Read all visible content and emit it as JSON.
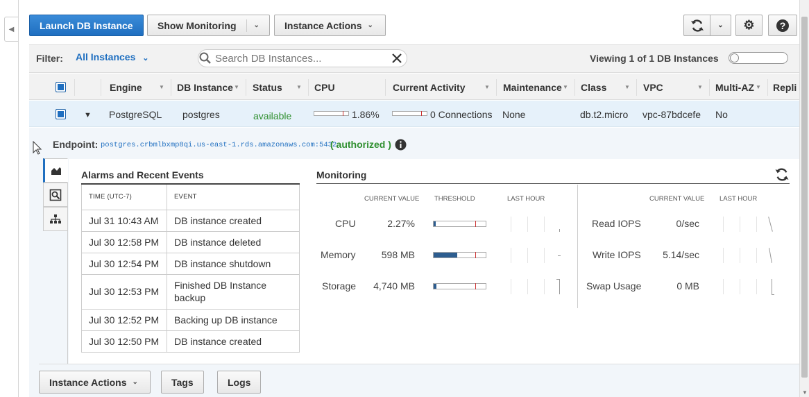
{
  "toolbar": {
    "launch_label": "Launch DB Instance",
    "show_monitoring_label": "Show Monitoring",
    "instance_actions_label": "Instance Actions"
  },
  "filter": {
    "label": "Filter:",
    "value": "All Instances",
    "search_placeholder": "Search DB Instances...",
    "viewing_text": "Viewing 1 of 1 DB Instances"
  },
  "table": {
    "columns": [
      "Engine",
      "DB Instance",
      "Status",
      "CPU",
      "Current Activity",
      "Maintenance",
      "Class",
      "VPC",
      "Multi-AZ",
      "Repli"
    ],
    "row": {
      "engine": "PostgreSQL",
      "db_instance": "postgres",
      "status": "available",
      "cpu": "1.86%",
      "cpu_fraction": 0.0186,
      "current_activity": "0 Connections",
      "maintenance": "None",
      "class": "db.t2.micro",
      "vpc": "vpc-87bdcefe",
      "multi_az": "No"
    }
  },
  "detail": {
    "endpoint_label": "Endpoint:",
    "endpoint_value": "postgres.crbmlbxmp8qi.us-east-1.rds.amazonaws.com:5432",
    "authorized": "( authorized )",
    "alarms_title": "Alarms and Recent Events",
    "events_header_time": "Time (UTC-7)",
    "events_header_event": "Event",
    "events": [
      {
        "time": "Jul 31 10:43 AM",
        "event": "DB instance created"
      },
      {
        "time": "Jul 30 12:58 PM",
        "event": "DB instance deleted"
      },
      {
        "time": "Jul 30 12:54 PM",
        "event": "DB instance shutdown"
      },
      {
        "time": "Jul 30 12:53 PM",
        "event": "Finished DB Instance backup"
      },
      {
        "time": "Jul 30 12:52 PM",
        "event": "Backing up DB instance"
      },
      {
        "time": "Jul 30 12:50 PM",
        "event": "DB instance created"
      }
    ],
    "monitoring_title": "Monitoring",
    "mon_headers": {
      "current_value": "Current Value",
      "threshold": "Threshold",
      "last_hour": "Last Hour"
    },
    "metrics_left": [
      {
        "label": "CPU",
        "value": "2.27%",
        "fill": 0.02
      },
      {
        "label": "Memory",
        "value": "598 MB",
        "fill": 0.45
      },
      {
        "label": "Storage",
        "value": "4,740 MB",
        "fill": 0.05
      }
    ],
    "metrics_right": [
      {
        "label": "Read IOPS",
        "value": "0/sec"
      },
      {
        "label": "Write IOPS",
        "value": "5.14/sec"
      },
      {
        "label": "Swap Usage",
        "value": "0 MB"
      }
    ]
  },
  "bottom": {
    "instance_actions_label": "Instance Actions",
    "tags_label": "Tags",
    "logs_label": "Logs"
  },
  "colors": {
    "primary": "#1f6fc0",
    "status_available": "#2f8f2f",
    "link": "#1f6fc0"
  }
}
